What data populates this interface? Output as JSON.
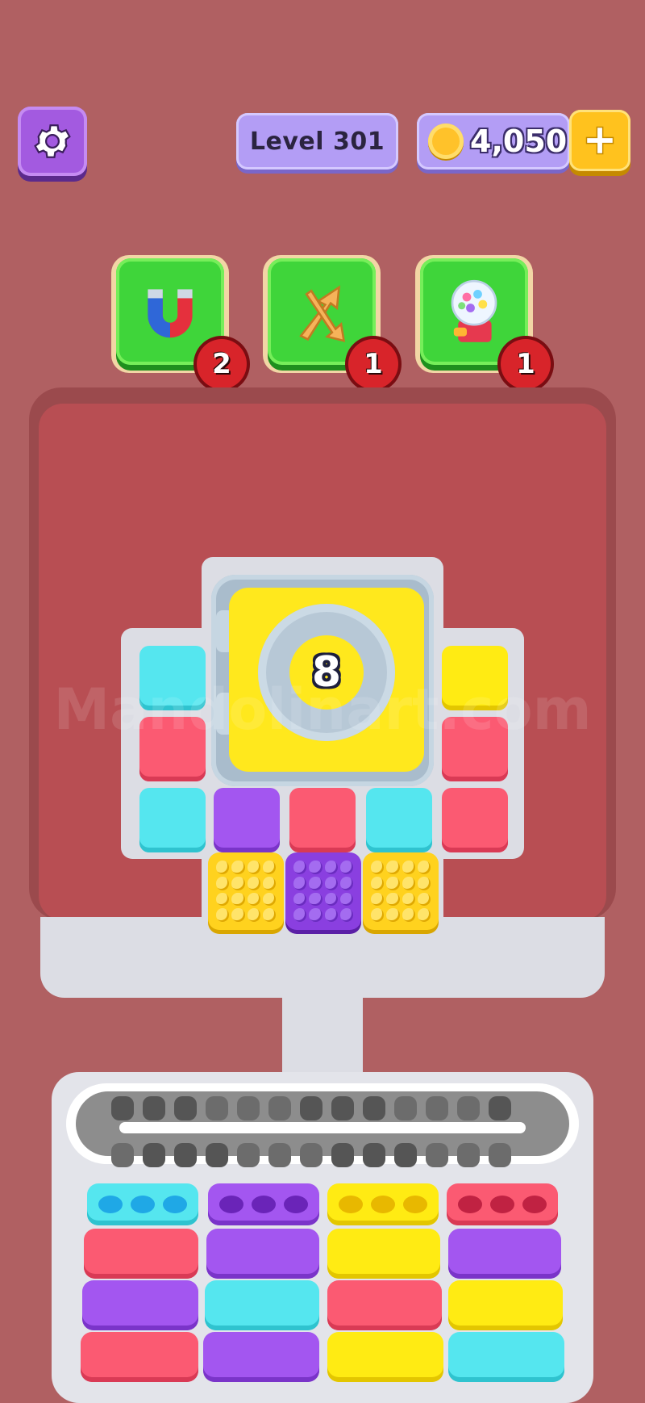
{
  "header": {
    "level_label": "Level 301",
    "coins": "4,050",
    "colors": {
      "settings": "#a35ae0",
      "pill": "#b39df5",
      "plus": "#ffc21e"
    }
  },
  "boosters": [
    {
      "name": "magnet",
      "count": "2"
    },
    {
      "name": "shuffle",
      "count": "1"
    },
    {
      "name": "gumball",
      "count": "1"
    }
  ],
  "vault": {
    "count": "8"
  },
  "watermark": "Mandolinart.com",
  "board": {
    "left_column": [
      "cyan",
      "pink",
      "cyan"
    ],
    "right_column": [
      "yellow",
      "pink",
      "pink"
    ],
    "middle_row": [
      "purple",
      "pink",
      "cyan"
    ],
    "bubble_row": [
      "yellow",
      "purple",
      "yellow"
    ]
  },
  "tray": {
    "heads": [
      "cyan",
      "purple",
      "yellow",
      "pink"
    ],
    "columns": [
      [
        "pink",
        "purple",
        "pink"
      ],
      [
        "purple",
        "cyan",
        "purple"
      ],
      [
        "yellow",
        "pink",
        "yellow"
      ],
      [
        "purple",
        "yellow",
        "cyan"
      ]
    ]
  }
}
